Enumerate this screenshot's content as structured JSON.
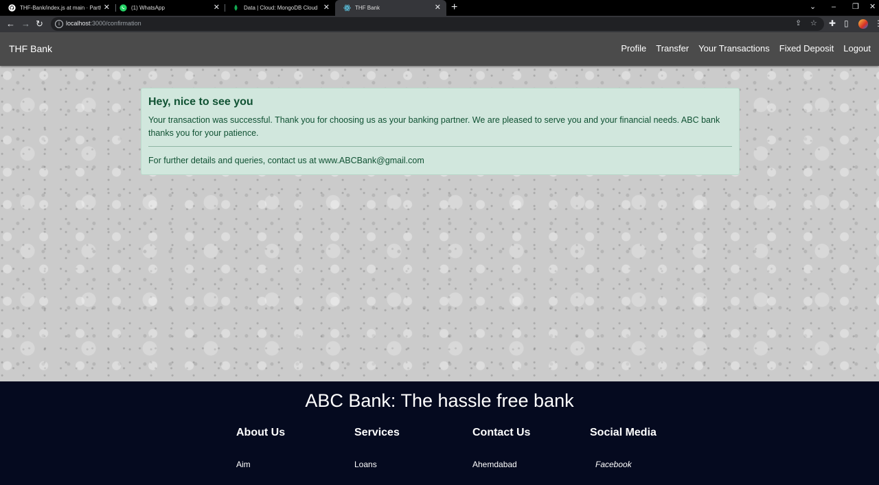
{
  "browser": {
    "tabs": [
      {
        "title": "THF-Bank/index.js at main · Parth",
        "icon": "github-icon"
      },
      {
        "title": "(1) WhatsApp",
        "icon": "whatsapp-icon"
      },
      {
        "title": "Data | Cloud: MongoDB Cloud",
        "icon": "mongodb-leaf-icon"
      },
      {
        "title": "THF Bank",
        "icon": "react-icon"
      }
    ],
    "address": {
      "host": "localhost",
      "path": ":3000/confirmation"
    }
  },
  "navbar": {
    "brand": "THF Bank",
    "links": [
      "Profile",
      "Transfer",
      "Your Transactions",
      "Fixed Deposit",
      "Logout"
    ]
  },
  "alert": {
    "heading": "Hey, nice to see you",
    "message": "Your transaction was successful. Thank you for choosing us as your banking partner. We are pleased to serve you and your financial needs. ABC bank thanks you for your patience.",
    "contact": "For further details and queries, contact us at www.ABCBank@gmail.com"
  },
  "footer": {
    "title": "ABC Bank: The hassle free bank",
    "columns": [
      {
        "heading": "About Us",
        "item": "Aim"
      },
      {
        "heading": "Services",
        "item": "Loans"
      },
      {
        "heading": "Contact Us",
        "item": "Ahemdabad"
      },
      {
        "heading": "Social Media",
        "item": "Facebook"
      }
    ]
  },
  "colors": {
    "navbar": "#4b4b4b",
    "alert_bg": "#d1e7dd",
    "alert_text": "#0f5132",
    "footer_bg": "#050a1f"
  }
}
